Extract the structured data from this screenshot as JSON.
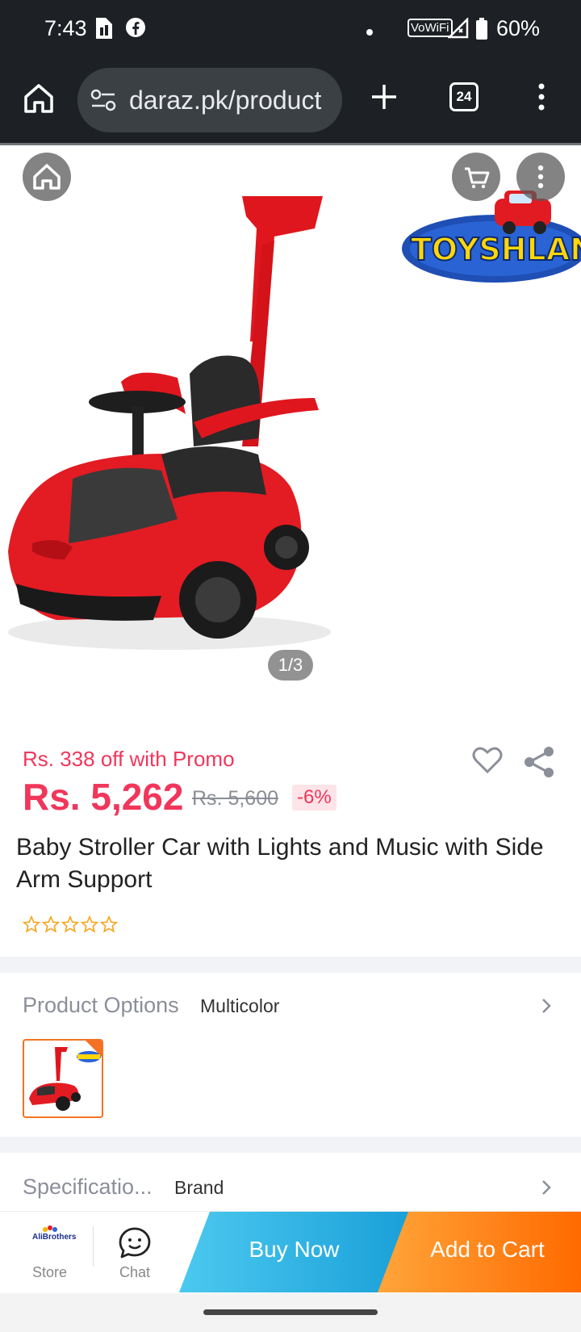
{
  "status_bar": {
    "time": "7:43",
    "vowifi": "VoWiFi",
    "battery": "60%"
  },
  "browser": {
    "url": "daraz.pk/product",
    "tab_count": "24"
  },
  "gallery": {
    "counter": "1/3",
    "brand_logo_text": "TOYSHLAND"
  },
  "product": {
    "promo": "Rs. 338 off with Promo",
    "price": "Rs. 5,262",
    "old_price": "Rs. 5,600",
    "discount": "-6%",
    "title": "Baby Stroller Car with Lights and Music with Side Arm Support",
    "rating_stars": 0
  },
  "options": {
    "label": "Product Options",
    "value": "Multicolor"
  },
  "specifications": {
    "label": "Specificatio...",
    "value": "Brand"
  },
  "bottom_bar": {
    "store_label": "Store",
    "store_logo_text": "AliBrothers",
    "chat_label": "Chat",
    "buy_now": "Buy Now",
    "add_to_cart": "Add to Cart"
  },
  "colors": {
    "price_red": "#f1365b",
    "accent_orange": "#f57224",
    "buy_blue": "#1aa0d8",
    "cart_orange": "#ff6a00",
    "chrome_dark": "#1d2125"
  }
}
